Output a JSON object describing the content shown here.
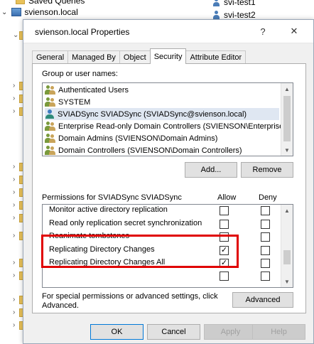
{
  "background": {
    "saved_queries": "Saved Queries",
    "domain": "svienson.local",
    "right_items": [
      "svi-test1",
      "svi-test2"
    ]
  },
  "dialog": {
    "title": "svienson.local Properties",
    "help_glyph": "?",
    "close_glyph": "✕",
    "tabs": [
      "General",
      "Managed By",
      "Object",
      "Security",
      "Attribute Editor"
    ],
    "active_tab": "Security",
    "group_label": "Group or user names:",
    "principals": [
      "Authenticated Users",
      "SYSTEM",
      "SVIADSync SVIADSync (SVIADSync@svienson.local)",
      "Enterprise Read-only Domain Controllers (SVIENSON\\Enterprise...",
      "Domain Admins (SVIENSON\\Domain Admins)",
      "Domain Controllers (SVIENSON\\Domain Controllers)"
    ],
    "add_button": "Add...",
    "remove_button": "Remove",
    "permissions_label": "Permissions for SVIADSync SVIADSync",
    "allow_header": "Allow",
    "deny_header": "Deny",
    "permissions": [
      {
        "name": "Monitor active directory replication",
        "allow": false,
        "deny": false
      },
      {
        "name": "Read only replication secret synchronization",
        "allow": false,
        "deny": false
      },
      {
        "name": "Reanimate tombstones",
        "allow": false,
        "deny": false
      },
      {
        "name": "Replicating Directory Changes",
        "allow": true,
        "deny": false
      },
      {
        "name": "Replicating Directory Changes All",
        "allow": true,
        "deny": false
      }
    ],
    "special_text_1": "For special permissions or advanced settings, click",
    "special_text_2": "Advanced.",
    "advanced_button": "Advanced",
    "ok_button": "OK",
    "cancel_button": "Cancel",
    "apply_button": "Apply",
    "help_button": "Help",
    "highlight_color": "#e00000"
  }
}
